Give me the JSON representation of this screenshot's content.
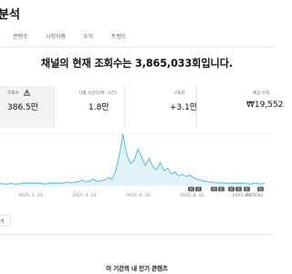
{
  "page": {
    "title": "분석"
  },
  "tabs": [
    {
      "label": "콘텐츠"
    },
    {
      "label": "시청자층"
    },
    {
      "label": "수익"
    },
    {
      "label": "트렌드"
    }
  ],
  "headline": "채널의 현재 조회수는 3,865,033회입니다.",
  "metrics": [
    {
      "label": "조회수",
      "value": "386.5만",
      "icon": "warning-icon",
      "active": true
    },
    {
      "label": "시청 시간(단위: 시간)",
      "value": "1.8만"
    },
    {
      "label": "구독자",
      "value": "+3.1만"
    },
    {
      "label": "예상 수익",
      "value": "₩19,552"
    }
  ],
  "chart_data": {
    "type": "area",
    "x_tick_labels": [
      "2025. 2. 12.",
      "2025. 4. 13.",
      "2025. 6. 12.",
      "2025. 8. 11.",
      "2025. 10. 10.",
      "2025. 12."
    ],
    "note_badges": [
      "Pr",
      "Pr",
      "Pr",
      "Pr",
      "Pr",
      "Pr",
      "Pr",
      "Pr"
    ],
    "series": [
      {
        "values": [
          0.04,
          0.03,
          0.03,
          0.04,
          0.03,
          0.03,
          0.04,
          0.05,
          0.04,
          0.04,
          0.05,
          0.04,
          0.03,
          0.04,
          0.05,
          0.04,
          0.04,
          0.05,
          0.06,
          0.05,
          0.06,
          0.07,
          0.1,
          0.07,
          0.08,
          0.12,
          0.08,
          0.09,
          0.1,
          0.15,
          0.12,
          0.26,
          0.58,
          0.98,
          0.6,
          0.42,
          0.48,
          0.7,
          0.55,
          0.38,
          0.52,
          0.36,
          0.3,
          0.44,
          0.28,
          0.33,
          0.22,
          0.26,
          0.18,
          0.22,
          0.17,
          0.2,
          0.14,
          0.12,
          0.1,
          0.08,
          0.07,
          0.06,
          0.05,
          0.05,
          0.05,
          0.04,
          0.04,
          0.04,
          0.05,
          0.04,
          0.04,
          0.03,
          0.04,
          0.04,
          0.03,
          0.04
        ]
      }
    ],
    "colors": {
      "line": "#41b4e0",
      "fill": "#e3f3fa",
      "grid": "#e5e5e5"
    }
  },
  "actions": {
    "more_label": "기"
  },
  "section": {
    "title": "이 기간의 내 인기 콘텐츠"
  }
}
